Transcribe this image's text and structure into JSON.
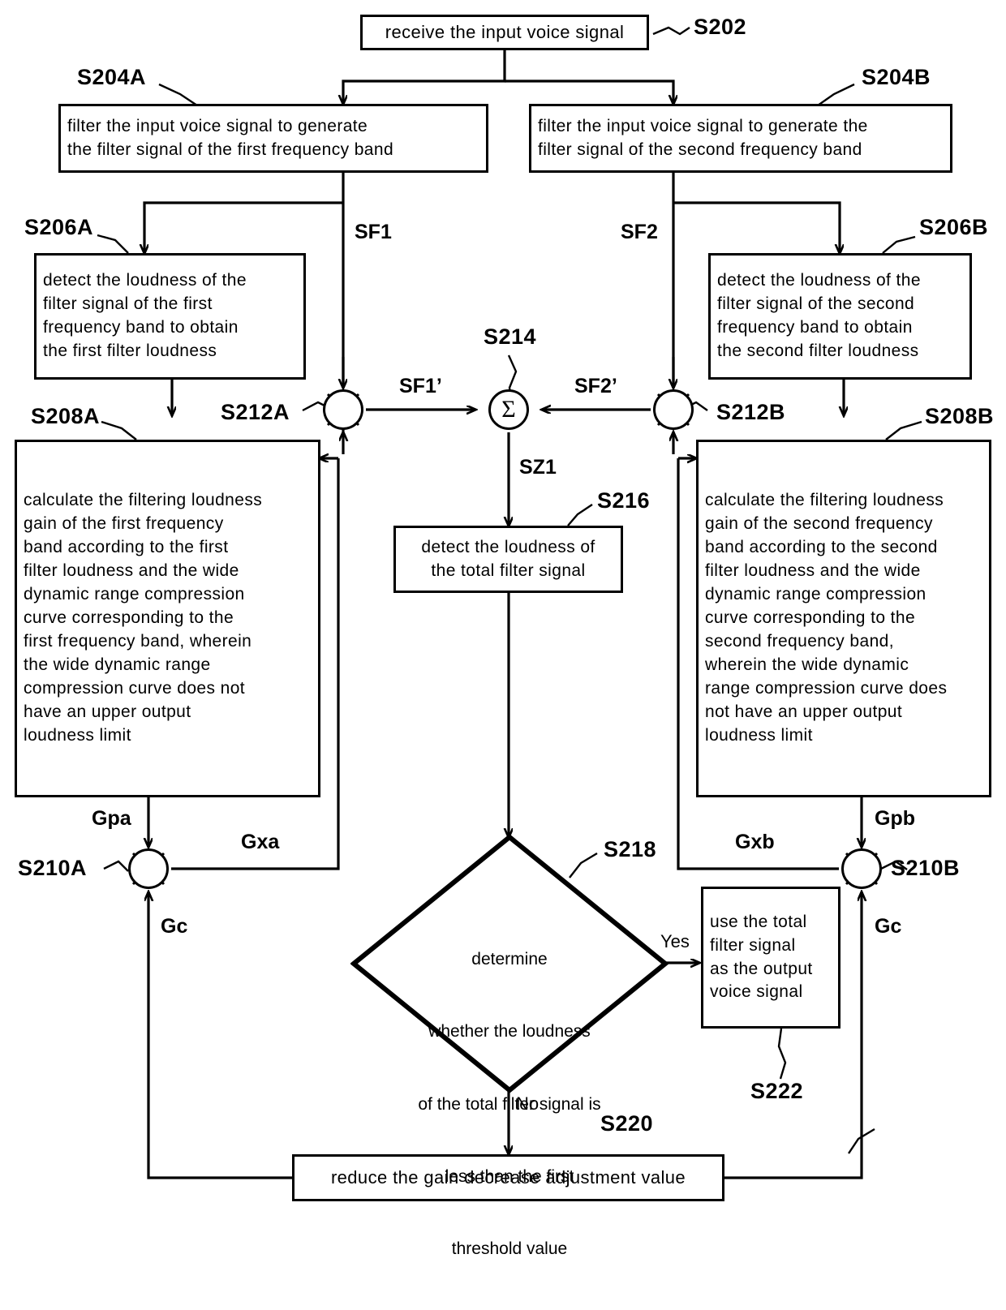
{
  "diagram": {
    "type": "patent-flowchart",
    "title": "Voice signal wide dynamic range compression process",
    "nodes": {
      "s202": {
        "ref": "S202",
        "lines": [
          "receive the input voice signal"
        ]
      },
      "s204a": {
        "ref": "S204A",
        "lines": [
          "filter the input voice signal to generate",
          "the filter signal of the first frequency band"
        ]
      },
      "s204b": {
        "ref": "S204B",
        "lines": [
          "filter the input voice signal to generate the",
          "filter signal of the second frequency band"
        ]
      },
      "s206a": {
        "ref": "S206A",
        "lines": [
          "detect the loudness of the",
          "filter signal of the first",
          "frequency band to obtain",
          "the first filter loudness"
        ]
      },
      "s206b": {
        "ref": "S206B",
        "lines": [
          "detect the loudness of the",
          "filter signal of the second",
          "frequency band to obtain",
          "the second filter loudness"
        ]
      },
      "s208a": {
        "ref": "S208A",
        "lines": [
          "calculate the filtering loudness",
          "gain of the first frequency",
          "band according to the first",
          "filter loudness and the wide",
          "dynamic range compression",
          "curve corresponding to the",
          "first frequency band, wherein",
          "the wide dynamic range",
          "compression curve does not",
          "have an upper output",
          "loudness limit"
        ]
      },
      "s208b": {
        "ref": "S208B",
        "lines": [
          "calculate the filtering loudness",
          "gain of the second frequency",
          "band according to the second",
          "filter loudness and the wide",
          "dynamic range compression",
          "curve corresponding to the",
          "second frequency band,",
          "wherein the wide dynamic",
          "range compression curve does",
          "not have an upper output",
          "loudness limit"
        ]
      },
      "s210a": {
        "ref": "S210A",
        "op": "multiply-node"
      },
      "s210b": {
        "ref": "S210B",
        "op": "multiply-node"
      },
      "s212a": {
        "ref": "S212A",
        "op": "multiply-node"
      },
      "s212b": {
        "ref": "S212B",
        "op": "multiply-node"
      },
      "s214": {
        "ref": "S214",
        "op": "sum-node",
        "glyph": "Σ"
      },
      "s216": {
        "ref": "S216",
        "lines": [
          "detect the loudness of",
          "the total filter signal"
        ]
      },
      "s218": {
        "ref": "S218",
        "lines": [
          "determine",
          "whether the loudness",
          "of the total filter signal is",
          "less than the first",
          "threshold value"
        ]
      },
      "s220": {
        "ref": "S220",
        "lines": [
          "reduce the gain decrease adjustment value"
        ]
      },
      "s222": {
        "ref": "S222",
        "lines": [
          "use the total",
          "filter signal",
          "as the output",
          "voice signal"
        ]
      }
    },
    "signals": {
      "sf1": "SF1",
      "sf2": "SF2",
      "sf1p": "SF1’",
      "sf2p": "SF2’",
      "sz1": "SZ1",
      "gpa": "Gpa",
      "gpb": "Gpb",
      "gxa": "Gxa",
      "gxb": "Gxb",
      "gc_left": "Gc",
      "gc_right": "Gc"
    },
    "branch_labels": {
      "yes": "Yes",
      "no": "No"
    },
    "colors": {
      "stroke": "#000000",
      "background": "#ffffff"
    }
  }
}
